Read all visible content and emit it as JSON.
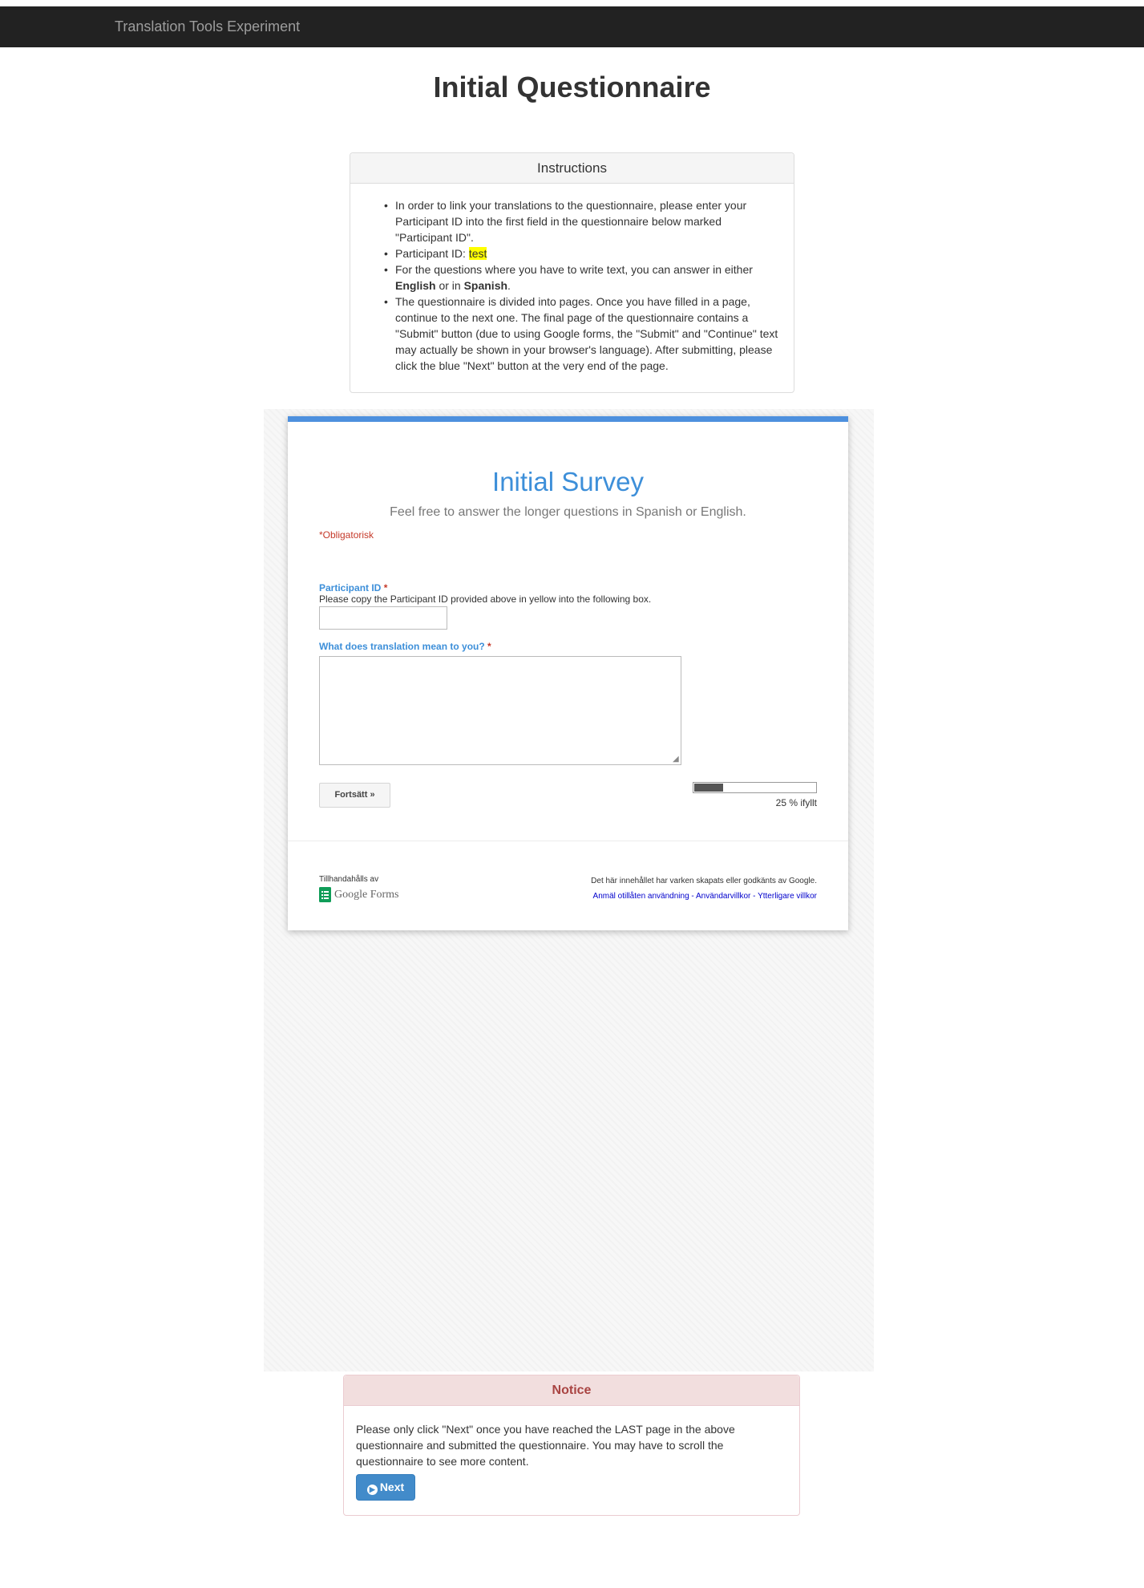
{
  "navbar": {
    "brand": "Translation Tools Experiment"
  },
  "page": {
    "title": "Initial Questionnaire"
  },
  "instructions": {
    "heading": "Instructions",
    "item1": "In order to link your translations to the questionnaire, please enter your Participant ID into the first field in the questionnaire below marked \"Participant ID\".",
    "item2_prefix": "Participant ID: ",
    "participant_id": "test",
    "item3_part1": "For the questions where you have to write text, you can answer in either ",
    "item3_english": "English",
    "item3_part2": " or in ",
    "item3_spanish": "Spanish",
    "item3_part3": ".",
    "item4": "The questionnaire is divided into pages. Once you have filled in a page, continue to the next one. The final page of the questionnaire contains a \"Submit\" button (due to using Google forms, the \"Submit\" and \"Continue\" text may actually be shown in your browser's language). After submitting, please click the blue \"Next\" button at the very end of the page."
  },
  "survey": {
    "title": "Initial Survey",
    "description": "Feel free to answer the longer questions in Spanish or English.",
    "required_note": "*Obligatorisk",
    "q1": {
      "label": "Participant ID",
      "star": "*",
      "help": "Please copy the Participant ID provided above in yellow into the following box.",
      "value": ""
    },
    "q2": {
      "label": "What does translation mean to you?",
      "star": "*",
      "value": ""
    },
    "continue_label": "Fortsätt »",
    "progress": {
      "percent": 25,
      "label": "25 % ifyllt"
    },
    "provided_by": "Tillhandahålls av",
    "google_forms_label": "Google Forms",
    "disclaimer": "Det här innehållet har varken skapats eller godkänts av Google.",
    "links": {
      "report": "Anmäl otillåten användning",
      "terms": "Användarvillkor",
      "additional": "Ytterligare villkor",
      "separator": " - "
    }
  },
  "notice": {
    "heading": "Notice",
    "body": "Please only click \"Next\" once you have reached the LAST page in the above questionnaire and submitted the questionnaire. You may have to scroll the questionnaire to see more content.",
    "next_label": "Next"
  },
  "colors": {
    "navbar": "#222222",
    "survey_accent": "#4d90de",
    "required": "#c53929",
    "notice_bg": "#f2dede",
    "next_button": "#428bca",
    "highlight": "#ffff00"
  },
  "icons": {
    "next_button_icon": "arrow-circle-right-icon",
    "google_forms_icon": "google-forms-icon"
  }
}
